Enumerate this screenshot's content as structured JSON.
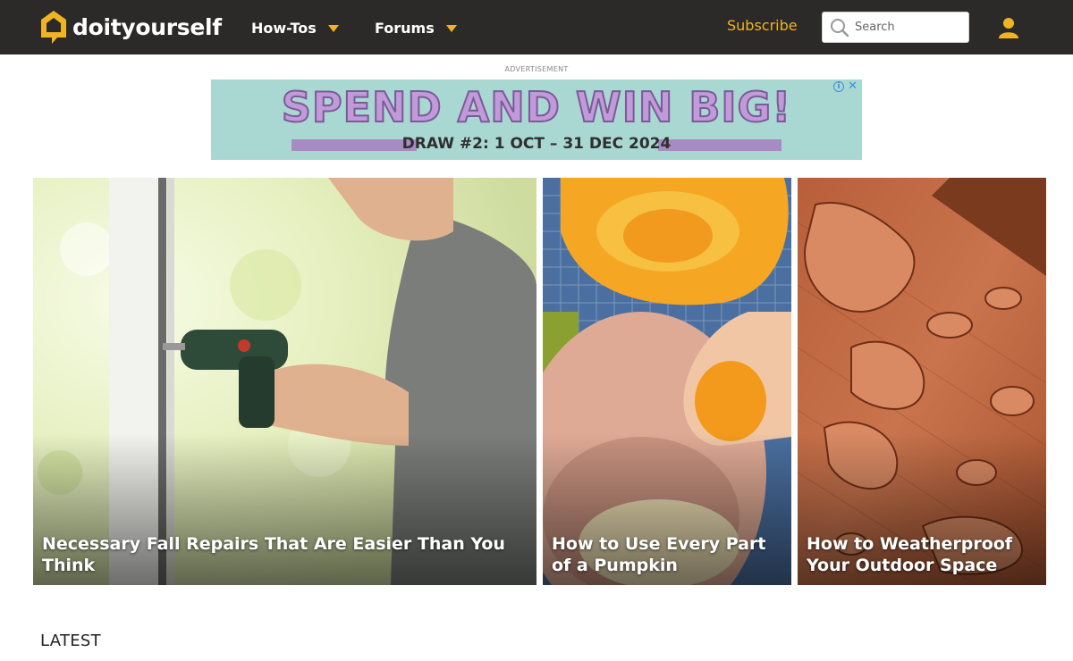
{
  "header": {
    "logo_text": "doityourself",
    "nav": [
      {
        "label": "How-Tos"
      },
      {
        "label": "Forums"
      }
    ],
    "subscribe_label": "Subscribe",
    "search_placeholder": "Search",
    "brand_color": "#f0b323",
    "bar_color": "#2b2a29"
  },
  "ad": {
    "label": "ADVERTISEMENT",
    "headline": "SPEND AND WIN BIG!",
    "subline": "DRAW #2: 1 OCT – 31 DEC 2024",
    "info_icon": "info-icon",
    "close_icon": "close-icon",
    "background_color": "#a9d8d2"
  },
  "featured": [
    {
      "title": "Necessary Fall Repairs That Are Easier Than You Think",
      "image": "man-with-drill-at-window"
    },
    {
      "title": "How to Use Every Part of a Pumpkin",
      "image": "pumpkin-seeds"
    },
    {
      "title": "How to Weatherproof Your Outdoor Space",
      "image": "water-droplets-on-wood"
    }
  ],
  "sections": {
    "latest_heading": "LATEST"
  }
}
